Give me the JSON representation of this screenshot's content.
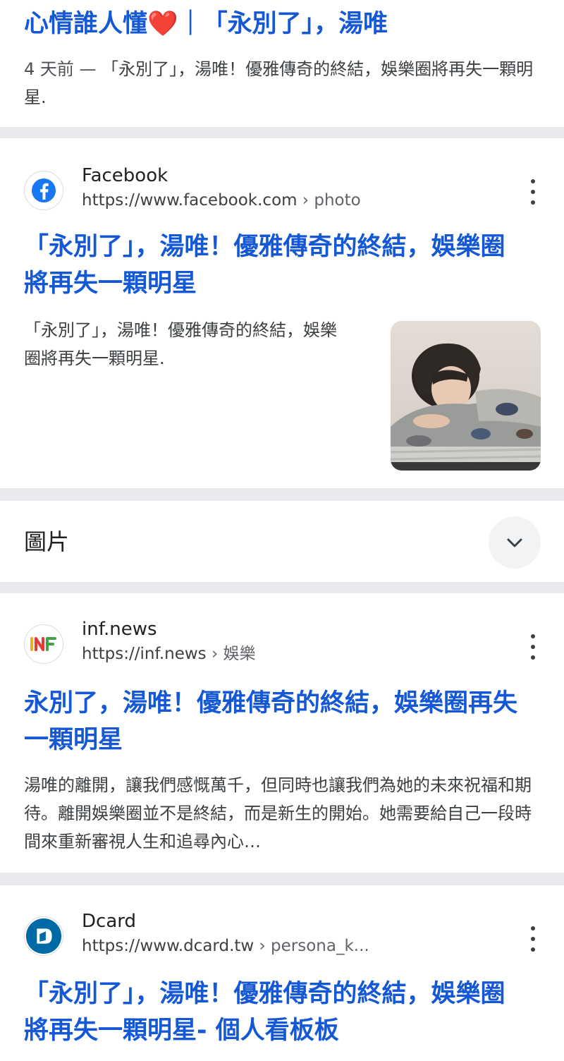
{
  "top_result": {
    "title": "心情誰人懂❤️｜「永別了」，湯唯",
    "date": "4 天前 —",
    "snippet": " 「永別了」，湯唯！優雅傳奇的終結，娛樂圈將再失一顆明星."
  },
  "results": [
    {
      "site_name": "Facebook",
      "url_host": "https://www.facebook.com",
      "url_path": " › photo",
      "title": "「永別了」，湯唯！優雅傳奇的終結，娛樂圈將再失一顆明星",
      "snippet": "「永別了」，湯唯！優雅傳奇的終結，娛樂圈將再失一顆明星.",
      "icon": "facebook-icon",
      "icon_color": "#1877f2"
    },
    {
      "site_name": "inf.news",
      "url_host": "https://inf.news",
      "url_path": " › 娛樂",
      "title": "永別了，湯唯！優雅傳奇的終結，娛樂圈再失一顆明星",
      "snippet": "湯唯的離開，讓我們感慨萬千，但同時也讓我們為她的未來祝福和期待。離開娛樂圈並不是終結，而是新生的開始。她需要給自己一段時間來重新審視人生和追尋內心…",
      "icon": "inf-news-icon"
    },
    {
      "site_name": "Dcard",
      "url_host": "https://www.dcard.tw",
      "url_path": " › persona_k...",
      "title": "「永別了」，湯唯！優雅傳奇的終結，娛樂圈將再失一顆明星- 個人看板板",
      "icon": "dcard-icon",
      "icon_color": "#006aa6"
    }
  ],
  "images_section": {
    "label": "圖片",
    "expand_icon": "chevron-down-icon"
  },
  "colors": {
    "link": "#1558d6",
    "separator": "#e8eaed"
  }
}
